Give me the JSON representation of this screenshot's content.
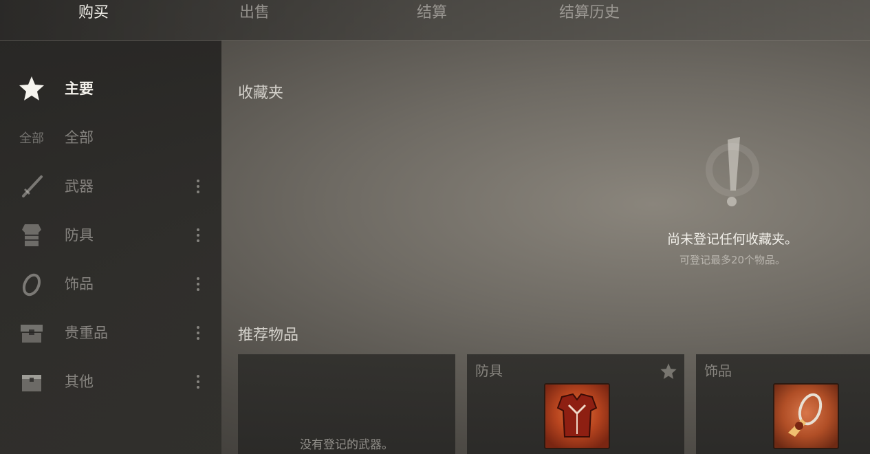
{
  "tabs": {
    "buy": "购买",
    "sell": "出售",
    "settle": "结算",
    "history": "结算历史"
  },
  "sidebar": {
    "items": [
      {
        "label": "主要",
        "icon": "star-icon",
        "active": true
      },
      {
        "label": "全部",
        "icon_text": "全部"
      },
      {
        "label": "武器",
        "icon": "sword-icon"
      },
      {
        "label": "防具",
        "icon": "armor-icon"
      },
      {
        "label": "饰品",
        "icon": "ring-icon"
      },
      {
        "label": "贵重品",
        "icon": "chest-icon"
      },
      {
        "label": "其他",
        "icon": "box-icon"
      }
    ]
  },
  "favorites": {
    "title": "收藏夹",
    "empty_main": "尚未登记任何收藏夹。",
    "empty_sub": "可登记最多20个物品。"
  },
  "recommended": {
    "title": "推荐物品",
    "cards": [
      {
        "category": "",
        "empty_text": "没有登记的武器。"
      },
      {
        "category": "防具",
        "thumb_icon": "red-armor-icon"
      },
      {
        "category": "饰品",
        "thumb_icon": "accessory-icon"
      }
    ]
  },
  "colors": {
    "accent_item_bg": "#c0501f",
    "active_text": "#f4f2ec",
    "inactive_text": "#a9a69f"
  }
}
